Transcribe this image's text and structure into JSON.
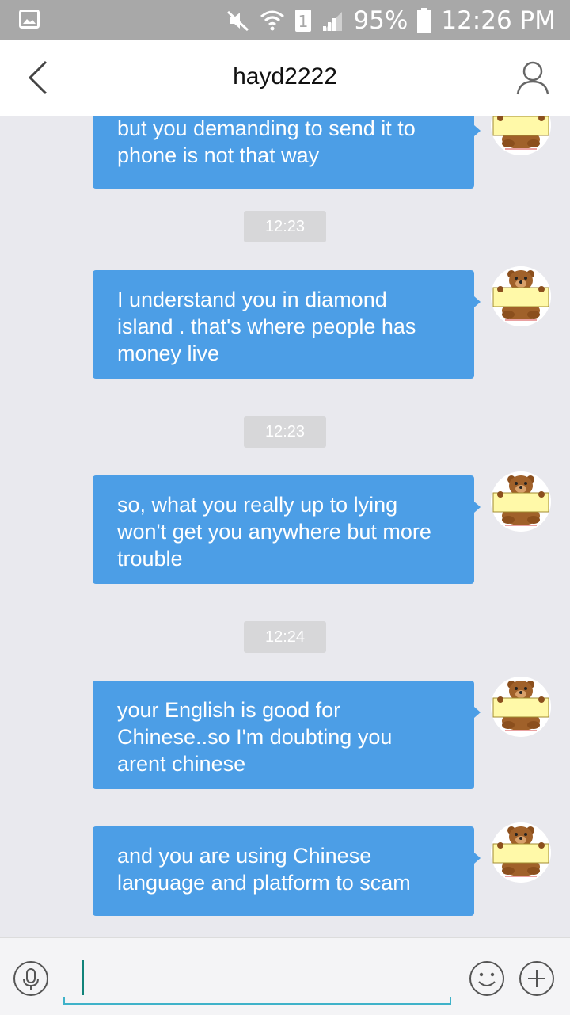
{
  "status_bar": {
    "battery": "95%",
    "time": "12:26 PM",
    "sim_slot": "1",
    "icons": [
      "gallery-icon",
      "mute-icon",
      "wifi-icon",
      "sim-icon",
      "signal-icon",
      "battery-icon"
    ]
  },
  "header": {
    "title": "hayd2222",
    "back_icon": "chevron-left-icon",
    "profile_icon": "person-icon"
  },
  "messages": [
    {
      "type": "outgoing",
      "lines": [
        "but you demanding to send it to",
        "phone is not that way"
      ]
    },
    {
      "type": "time",
      "text": "12:23"
    },
    {
      "type": "outgoing",
      "lines": [
        "I understand you in diamond",
        "island . that's where people has",
        "money live"
      ]
    },
    {
      "type": "time",
      "text": "12:23"
    },
    {
      "type": "outgoing",
      "lines": [
        "so, what you really up to lying",
        "won't get you anywhere but more",
        "trouble"
      ]
    },
    {
      "type": "time",
      "text": "12:24"
    },
    {
      "type": "outgoing",
      "lines": [
        "your English is good for",
        "Chinese..so I'm doubting you",
        "arent chinese"
      ]
    },
    {
      "type": "outgoing",
      "lines": [
        "and you are using Chinese",
        "language and platform to scam"
      ]
    }
  ],
  "input_bar": {
    "voice_icon": "microphone-icon",
    "input_value": "",
    "emoji_icon": "smiley-icon",
    "plus_icon": "plus-icon"
  },
  "colors": {
    "bubble": "#4c9ee6",
    "chat_bg": "#e9e9ee",
    "status_bar": "#a8a8a8",
    "input_accent": "#3fb2c9"
  }
}
